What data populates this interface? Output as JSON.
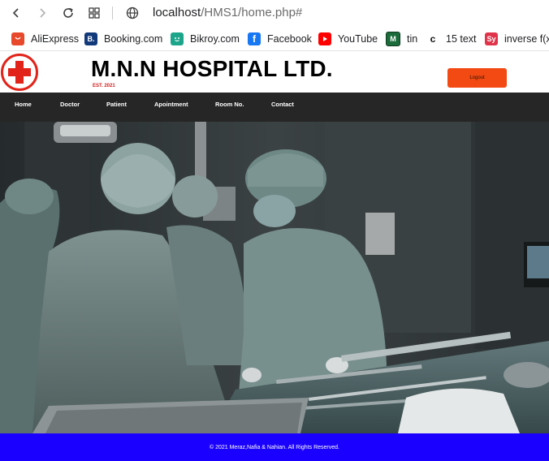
{
  "browser": {
    "url_host": "localhost",
    "url_path": "/HMS1/home.php#"
  },
  "bookmarks": [
    {
      "label": "AliExpress",
      "icon": "aliexpress-icon",
      "color": "#e8492c"
    },
    {
      "label": "Booking.com",
      "icon": "booking-icon",
      "color": "#123a7a"
    },
    {
      "label": "Bikroy.com",
      "icon": "bikroy-icon",
      "color": "#1ca58a"
    },
    {
      "label": "Facebook",
      "icon": "facebook-icon",
      "color": "#1877f2"
    },
    {
      "label": "YouTube",
      "icon": "youtube-icon",
      "color": "#ff0000"
    },
    {
      "label": "tin",
      "icon": "tin-icon",
      "color": "#1c6b3a"
    },
    {
      "label": "15 text",
      "icon": "text-c-icon",
      "color": "#111111"
    },
    {
      "label": "inverse f(x)",
      "icon": "symbolab-icon",
      "color": "#e0344a"
    }
  ],
  "site": {
    "title": "M.N.N HOSPITAL LTD.",
    "est": "EST. 2021",
    "logout_label": "Logout"
  },
  "nav": {
    "items": [
      {
        "label": "Home"
      },
      {
        "label": "Doctor"
      },
      {
        "label": "Patient"
      },
      {
        "label": "Apointment"
      },
      {
        "label": "Room No."
      },
      {
        "label": "Contact"
      }
    ]
  },
  "footer": {
    "text": "© 2021 Meraz,Nafia & Nahian. All Rights Reserved."
  },
  "colors": {
    "logout": "#f24a12",
    "nav_bg": "#262626",
    "footer_bg": "#1a00ff",
    "logo_red": "#e2231a"
  }
}
